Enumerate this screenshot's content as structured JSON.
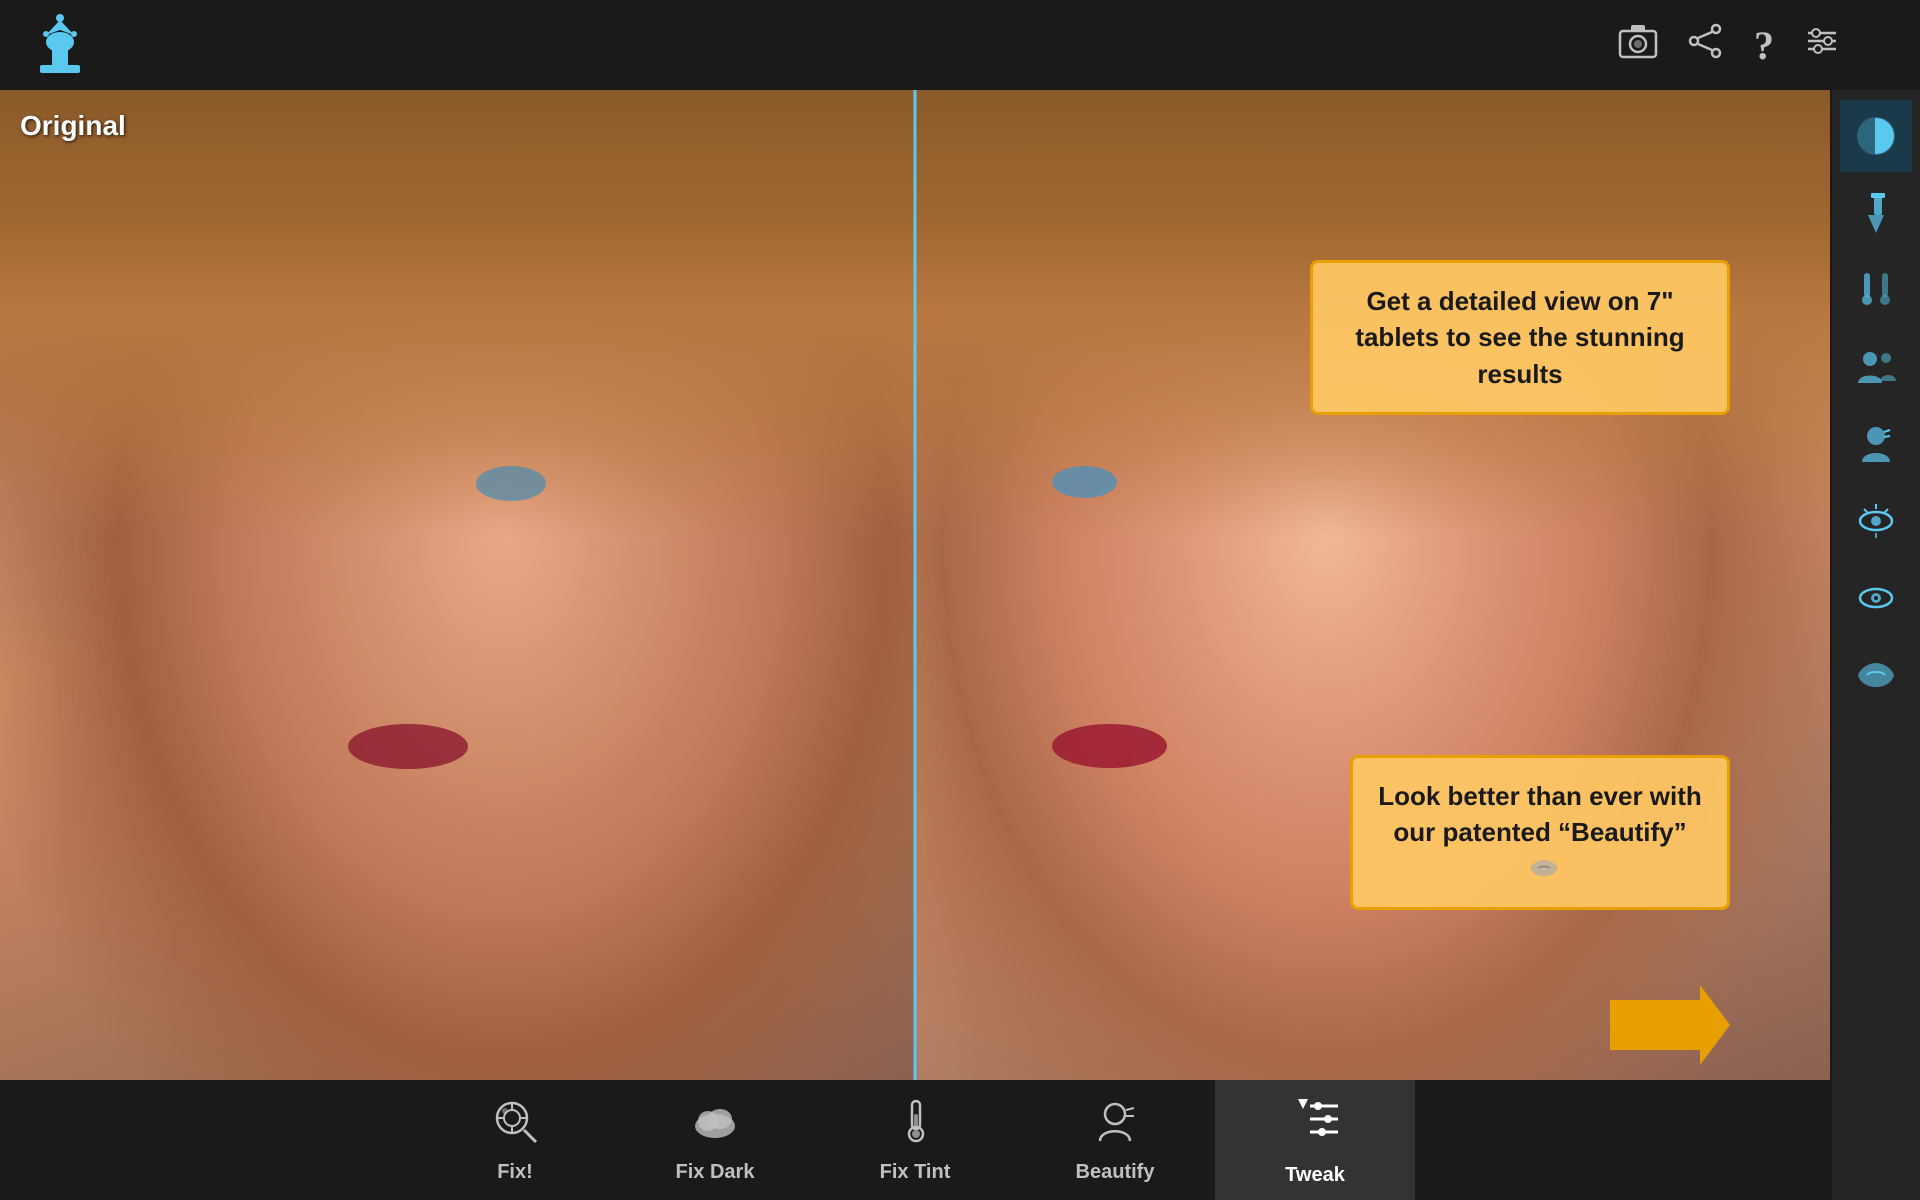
{
  "header": {
    "logo_alt": "YouCam Perfect Logo",
    "icons": {
      "camera": "📷",
      "share": "🔗",
      "help": "?",
      "settings": "⚙"
    }
  },
  "image": {
    "original_label": "Original",
    "divider_color": "#5bc8f0"
  },
  "tooltips": {
    "top": {
      "text": "Get a detailed view on 7\" tablets to see the stunning results"
    },
    "bottom": {
      "text": "Look better than ever with our patented “Beautify”"
    }
  },
  "toolbar": {
    "items": [
      {
        "id": "fix",
        "label": "Fix!",
        "icon": "🎨"
      },
      {
        "id": "fix-dark",
        "label": "Fix Dark",
        "icon": "☁"
      },
      {
        "id": "fix-tint",
        "label": "Fix Tint",
        "icon": "🌡"
      },
      {
        "id": "beautify",
        "label": "Beautify",
        "icon": "👤"
      },
      {
        "id": "tweak",
        "label": "Tweak",
        "icon": "⊞"
      }
    ],
    "active": "tweak"
  },
  "sidebar": {
    "items": [
      {
        "id": "split",
        "icon": "◑",
        "label": "Split View"
      },
      {
        "id": "dropper",
        "icon": "💉",
        "label": "Dropper"
      },
      {
        "id": "temperature",
        "icon": "🌡",
        "label": "Temperature"
      },
      {
        "id": "people",
        "icon": "👥",
        "label": "People"
      },
      {
        "id": "face",
        "icon": "😊",
        "label": "Face"
      },
      {
        "id": "eye",
        "icon": "👁",
        "label": "Eye"
      },
      {
        "id": "eyepatch",
        "icon": "👁",
        "label": "Eye Detail"
      },
      {
        "id": "lips",
        "icon": "💋",
        "label": "Lips"
      }
    ]
  },
  "arrow": {
    "color": "#e8a000"
  }
}
